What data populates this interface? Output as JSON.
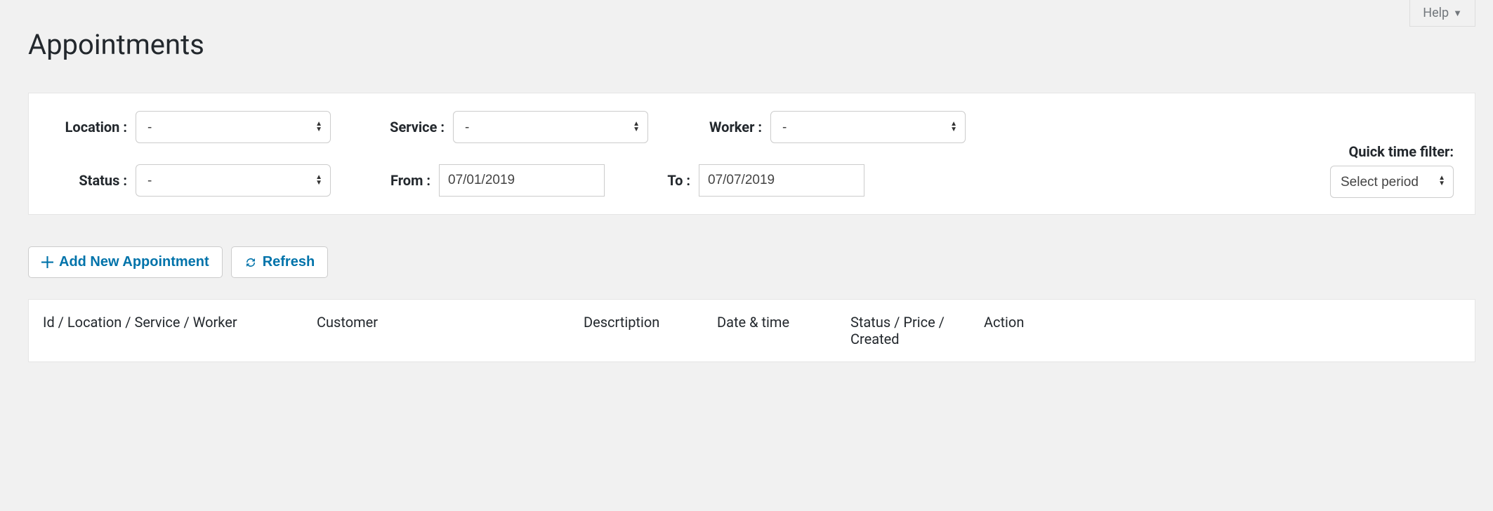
{
  "help": {
    "label": "Help"
  },
  "page": {
    "title": "Appointments"
  },
  "filters": {
    "location": {
      "label": "Location :",
      "value": "-"
    },
    "service": {
      "label": "Service :",
      "value": "-"
    },
    "worker": {
      "label": "Worker :",
      "value": "-"
    },
    "status": {
      "label": "Status :",
      "value": "-"
    },
    "from": {
      "label": "From :",
      "value": "07/01/2019"
    },
    "to": {
      "label": "To :",
      "value": "07/07/2019"
    },
    "quick": {
      "label": "Quick time filter:",
      "value": "Select period"
    }
  },
  "buttons": {
    "add": {
      "label": "Add New Appointment"
    },
    "refresh": {
      "label": "Refresh"
    }
  },
  "table": {
    "columns": {
      "c1": "Id / Location / Service / Worker",
      "c2": "Customer",
      "c3": "Descrtiption",
      "c4": "Date & time",
      "c5": "Status / Price / Created",
      "c6": "Action"
    }
  }
}
